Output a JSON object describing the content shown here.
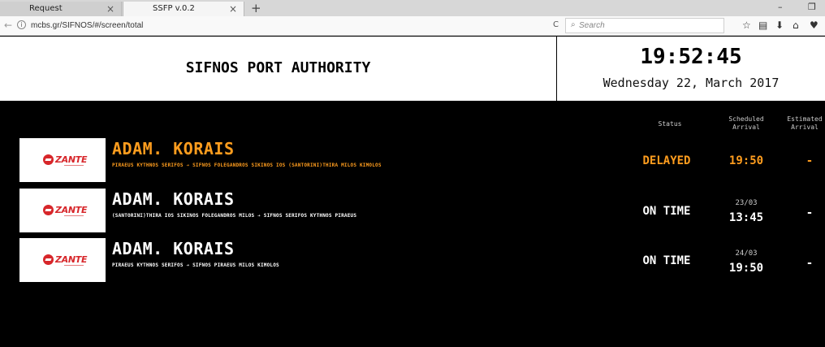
{
  "browser": {
    "tabs": [
      {
        "label": "Request",
        "close": "×"
      },
      {
        "label": "SSFP v.0.2",
        "close": "×"
      }
    ],
    "new_tab": "+",
    "minimize": "–",
    "restore": "❐",
    "back": "←",
    "info": "i",
    "url": "mcbs.gr/SIFNOS/#/screen/total",
    "reload": "C",
    "search_placeholder": "Search",
    "toolbar_icons": [
      "star-icon",
      "reading-list-icon",
      "download-icon",
      "home-icon",
      "pocket-icon"
    ]
  },
  "header": {
    "port_name": "SIFNOS PORT AUTHORITY",
    "time": "19:52:45",
    "date": "Wednesday 22, March 2017"
  },
  "columns": {
    "status": "Status",
    "scheduled_l1": "Scheduled",
    "scheduled_l2": "Arrival",
    "estimated_l1": "Estimated",
    "estimated_l2": "Arrival"
  },
  "logo_text": "ZANTE",
  "rows": [
    {
      "vessel": "ADAM. KORAIS",
      "route": "PIRAEUS KYTHNOS SERIFOS ➔ SIFNOS FOLEGANDROS SIKINOS IOS (SANTORINI)THIRA MILOS KIMOLOS",
      "status": "DELAYED",
      "arrival_date": "",
      "arrival_time": "19:50",
      "estimated": "-"
    },
    {
      "vessel": "ADAM. KORAIS",
      "route": "(SANTORINI)THIRA IOS SIKINOS FOLEGANDROS MILOS ➔ SIFNOS SERIFOS KYTHNOS PIRAEUS",
      "status": "ON TIME",
      "arrival_date": "23/03",
      "arrival_time": "13:45",
      "estimated": "-"
    },
    {
      "vessel": "ADAM. KORAIS",
      "route": "PIRAEUS KYTHNOS SERIFOS ➔ SIFNOS PIRAEUS MILOS KIMOLOS",
      "status": "ON TIME",
      "arrival_date": "24/03",
      "arrival_time": "19:50",
      "estimated": "-"
    }
  ],
  "colors": {
    "delayed": "#ff9d1e",
    "on_time": "#ffffff",
    "logo_red": "#d7262a"
  }
}
